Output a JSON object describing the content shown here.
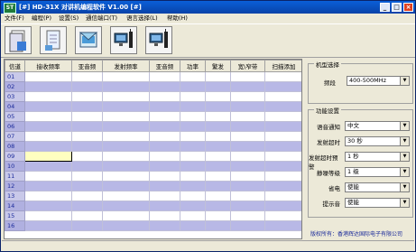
{
  "window": {
    "title": "[#] HD-31X 对讲机编程软件 V1.00 [#]",
    "app_icon": "ST"
  },
  "menu": [
    "文件(F)",
    "编程(P)",
    "设置(S)",
    "通信端口(T)",
    "语言选择(L)",
    "帮助(H)"
  ],
  "toolbar": [
    "open-icon",
    "save-icon",
    "new-file-icon",
    "read-radio-icon",
    "write-radio-icon"
  ],
  "grid": {
    "headers": [
      "信道",
      "接收频率",
      "亚音频",
      "发射频率",
      "亚音频",
      "功率",
      "繁发",
      "宽\\窄带",
      "扫描添加"
    ],
    "channels": [
      "01",
      "02",
      "03",
      "04",
      "05",
      "06",
      "07",
      "08",
      "09",
      "10",
      "11",
      "12",
      "13",
      "14",
      "15",
      "16"
    ]
  },
  "model_group": {
    "title": "机型选择",
    "band_label": "频段",
    "band_value": "400-500MHz"
  },
  "func_group": {
    "title": "功能设置",
    "items": [
      {
        "label": "语音通知",
        "value": "中文"
      },
      {
        "label": "发射超时",
        "value": "30 秒"
      },
      {
        "label": "发射超时预警",
        "value": "1 秒"
      },
      {
        "label": "静噪等级",
        "value": "1 级"
      },
      {
        "label": "省电",
        "value": "使能"
      },
      {
        "label": "提示音",
        "value": "使能"
      }
    ]
  },
  "footer": "版权所有：香港辉达国际电子有限公司"
}
